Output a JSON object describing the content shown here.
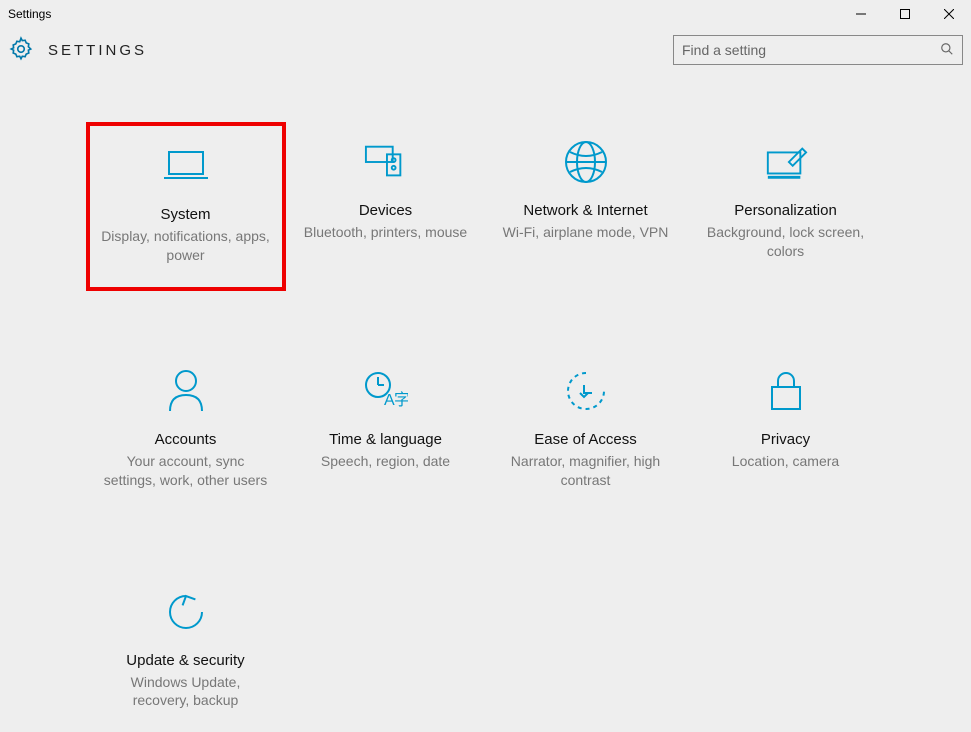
{
  "window": {
    "title": "Settings"
  },
  "header": {
    "title": "SETTINGS"
  },
  "search": {
    "placeholder": "Find a setting"
  },
  "tiles": [
    {
      "title": "System",
      "desc": "Display, notifications, apps, power",
      "icon": "laptop-icon",
      "highlight": true
    },
    {
      "title": "Devices",
      "desc": "Bluetooth, printers, mouse",
      "icon": "devices-icon",
      "highlight": false
    },
    {
      "title": "Network & Internet",
      "desc": "Wi-Fi, airplane mode, VPN",
      "icon": "globe-icon",
      "highlight": false
    },
    {
      "title": "Personalization",
      "desc": "Background, lock screen, colors",
      "icon": "personalization-icon",
      "highlight": false
    },
    {
      "title": "Accounts",
      "desc": "Your account, sync settings, work, other users",
      "icon": "person-icon",
      "highlight": false
    },
    {
      "title": "Time & language",
      "desc": "Speech, region, date",
      "icon": "time-language-icon",
      "highlight": false
    },
    {
      "title": "Ease of Access",
      "desc": "Narrator, magnifier, high contrast",
      "icon": "ease-access-icon",
      "highlight": false
    },
    {
      "title": "Privacy",
      "desc": "Location, camera",
      "icon": "lock-icon",
      "highlight": false
    },
    {
      "title": "Update & security",
      "desc": "Windows Update, recovery, backup",
      "icon": "update-icon",
      "highlight": false
    }
  ],
  "colors": {
    "accent": "#0099cc",
    "highlight": "#ee0000",
    "bg": "#eeeeee"
  }
}
